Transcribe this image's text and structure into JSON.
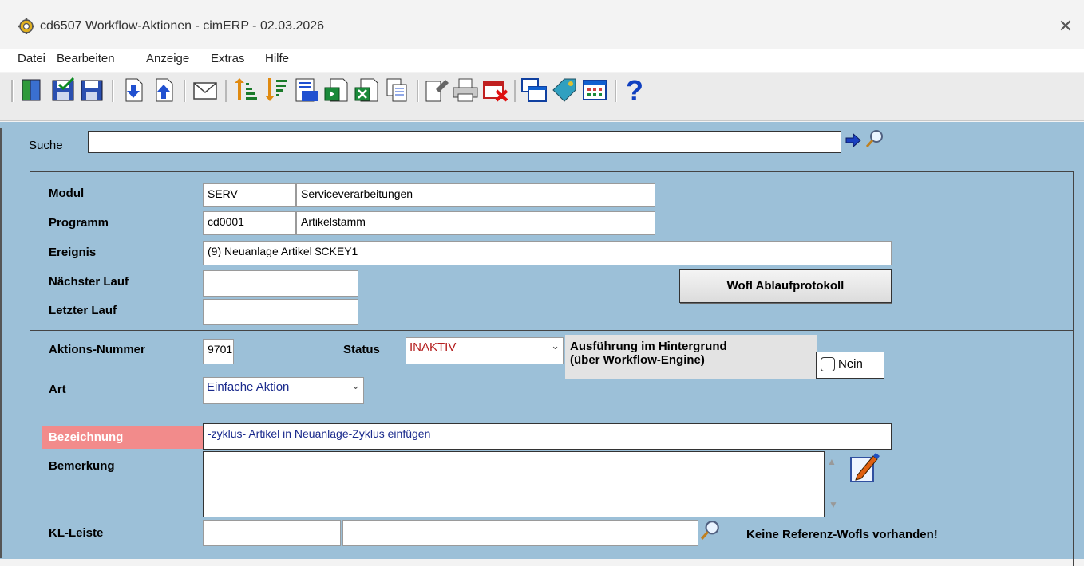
{
  "window": {
    "title": "cd6507 Workflow-Aktionen - cimERP - 02.03.2026",
    "close": "✕"
  },
  "menu": [
    "Datei",
    "Bearbeiten",
    "Anzeige",
    "Extras",
    "Hilfe"
  ],
  "toolbar": {
    "icons": [
      "exit-door-icon",
      "save-check-icon",
      "save-icon",
      "page-down-icon",
      "page-up-icon",
      "mail-icon",
      "sort-asc-icon",
      "sort-desc-icon",
      "counter-123-icon",
      "export-green-icon",
      "excel-icon",
      "copy-pages-icon",
      "edit-doc-icon",
      "print-icon",
      "delete-red-icon",
      "windows-icon",
      "tag-icon",
      "grid-icon",
      "help-icon"
    ]
  },
  "search": {
    "label": "Suche",
    "value": ""
  },
  "form": {
    "modul": {
      "label": "Modul",
      "code": "SERV",
      "text": "Serviceverarbeitungen"
    },
    "programm": {
      "label": "Programm",
      "code": "cd0001",
      "text": "Artikelstamm"
    },
    "ereignis": {
      "label": "Ereignis",
      "value": "(9) Neuanlage Artikel $CKEY1"
    },
    "naechster_lauf": {
      "label": "Nächster Lauf",
      "value": ""
    },
    "letzter_lauf": {
      "label": "Letzter Lauf",
      "value": ""
    },
    "wofl_button": "Wofl Ablaufprotokoll",
    "aktionsnummer": {
      "label": "Aktions-Nummer",
      "value": "9701"
    },
    "status": {
      "label": "Status",
      "value": "INAKTIV"
    },
    "hintergrund": {
      "label": "Ausführung im Hintergrund\n(über Workflow-Engine)",
      "checkbox_label": "Nein",
      "checked": false
    },
    "art": {
      "label": "Art",
      "value": "Einfache Aktion"
    },
    "bezeichnung": {
      "label": "Bezeichnung",
      "value": "-zyklus- Artikel in Neuanlage-Zyklus einfügen"
    },
    "bemerkung": {
      "label": "Bemerkung",
      "value": ""
    },
    "kl_leiste": {
      "label": "KL-Leiste",
      "value1": "",
      "value2": ""
    },
    "referenz_text": "Keine Referenz-Wofls vorhanden!"
  },
  "colors": {
    "panel_bg": "#9cc0d8",
    "status_text": "#b41e1e",
    "bez_label_bg": "#f28b8b",
    "value_text": "#1a2a8c"
  }
}
